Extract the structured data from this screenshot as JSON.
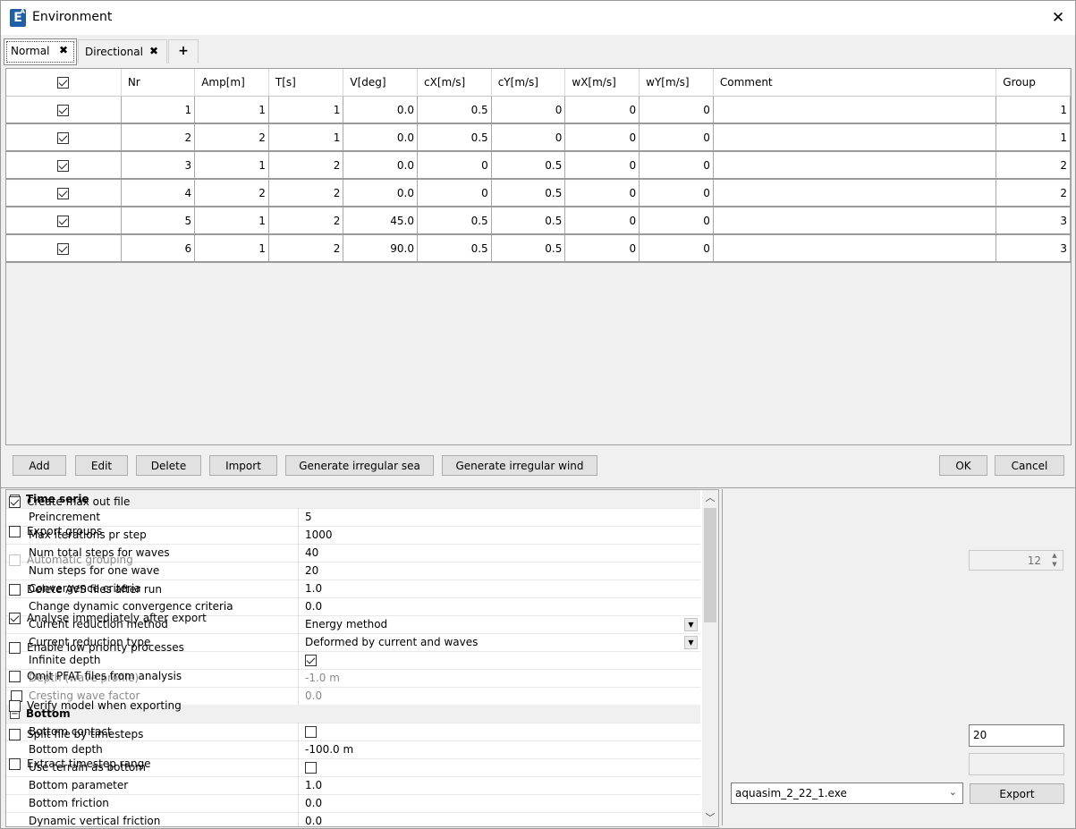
{
  "window": {
    "title": "Environment",
    "app_icon_letter": "E",
    "app_icon_sup": "A"
  },
  "tabs": [
    {
      "label": "Normal",
      "active": true
    },
    {
      "label": "Directional",
      "active": false
    }
  ],
  "add_tab_symbol": "+",
  "grid": {
    "columns": [
      "Nr",
      "Amp[m]",
      "T[s]",
      "V[deg]",
      "cX[m/s]",
      "cY[m/s]",
      "wX[m/s]",
      "wY[m/s]",
      "Comment",
      "Group"
    ],
    "rows": [
      {
        "checked": true,
        "nr": "1",
        "amp": "1",
        "t": "1",
        "v": "0.0",
        "cx": "0.5",
        "cy": "0",
        "wx": "0",
        "wy": "0",
        "comment": "",
        "group": "1"
      },
      {
        "checked": true,
        "nr": "2",
        "amp": "2",
        "t": "1",
        "v": "0.0",
        "cx": "0.5",
        "cy": "0",
        "wx": "0",
        "wy": "0",
        "comment": "",
        "group": "1"
      },
      {
        "checked": true,
        "nr": "3",
        "amp": "1",
        "t": "2",
        "v": "0.0",
        "cx": "0",
        "cy": "0.5",
        "wx": "0",
        "wy": "0",
        "comment": "",
        "group": "2"
      },
      {
        "checked": true,
        "nr": "4",
        "amp": "2",
        "t": "2",
        "v": "0.0",
        "cx": "0",
        "cy": "0.5",
        "wx": "0",
        "wy": "0",
        "comment": "",
        "group": "2"
      },
      {
        "checked": true,
        "nr": "5",
        "amp": "1",
        "t": "2",
        "v": "45.0",
        "cx": "0.5",
        "cy": "0.5",
        "wx": "0",
        "wy": "0",
        "comment": "",
        "group": "3"
      },
      {
        "checked": true,
        "nr": "6",
        "amp": "1",
        "t": "2",
        "v": "90.0",
        "cx": "0.5",
        "cy": "0.5",
        "wx": "0",
        "wy": "0",
        "comment": "",
        "group": "3"
      }
    ]
  },
  "buttons": {
    "add": "Add",
    "edit": "Edit",
    "delete": "Delete",
    "import": "Import",
    "gen_sea": "Generate irregular sea",
    "gen_wind": "Generate irregular wind",
    "ok": "OK",
    "cancel": "Cancel",
    "export": "Export"
  },
  "properties": {
    "time_serie": {
      "title": "Time serie",
      "preincrement": {
        "label": "Preincrement",
        "value": "5"
      },
      "max_iter": {
        "label": "Max iterations pr step",
        "value": "1000"
      },
      "num_total": {
        "label": "Num total steps for waves",
        "value": "40"
      },
      "num_one": {
        "label": "Num steps for one wave",
        "value": "20"
      },
      "convergence": {
        "label": "Convergence criteria",
        "value": "1.0"
      },
      "change_dyn": {
        "label": "Change dynamic convergence criteria",
        "value": "0.0"
      },
      "cur_method": {
        "label": "Current reduction method",
        "value": "Energy method"
      },
      "cur_type": {
        "label": "Current reduction type",
        "value": "Deformed by current and waves"
      },
      "infinite_depth": {
        "label": "Infinite depth",
        "checked": true
      },
      "depth_profile": {
        "label": "Depth (wave profile)",
        "value": "-1.0 m"
      },
      "cresting": {
        "label": "Cresting wave factor",
        "value": "0.0"
      }
    },
    "bottom": {
      "title": "Bottom",
      "contact": {
        "label": "Bottom contact",
        "checked": false
      },
      "depth": {
        "label": "Bottom depth",
        "value": "-100.0 m"
      },
      "terrain": {
        "label": "Use terrain as bottom",
        "checked": false
      },
      "parameter": {
        "label": "Bottom parameter",
        "value": "1.0"
      },
      "friction": {
        "label": "Bottom friction",
        "value": "0.0"
      },
      "dyn_vertical": {
        "label": "Dynamic vertical friction",
        "value": "0.0"
      }
    }
  },
  "options": {
    "create_max": {
      "label": "Create max out file",
      "checked": true
    },
    "export_groups": {
      "label": "Export groups",
      "checked": false
    },
    "auto_grouping": {
      "label": "Automatic grouping",
      "checked": false,
      "value": "12"
    },
    "delete_avs": {
      "label": "Delete AVS files after run",
      "checked": false
    },
    "analyse": {
      "label": "Analyse immediately after export",
      "checked": true
    },
    "low_priority": {
      "label": "Enable low priority processes",
      "checked": false
    },
    "omit_pfat": {
      "label": "Omit PFAT files from analysis",
      "checked": false
    },
    "verify": {
      "label": "Verify model when exporting",
      "checked": false
    },
    "split": {
      "label": "Split file by timesteps",
      "checked": false,
      "value": "20"
    },
    "extract": {
      "label": "Extract timestep range",
      "checked": false,
      "value": ""
    },
    "executable": "aquasim_2_22_1.exe"
  }
}
